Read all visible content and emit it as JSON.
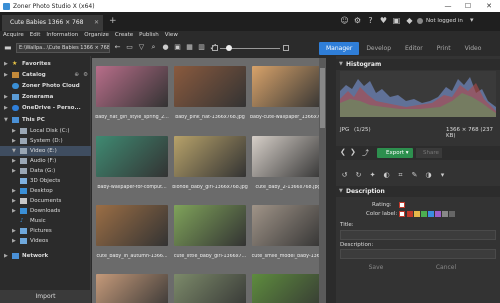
{
  "window": {
    "title": "Zoner Photo Studio X (x64)",
    "doc_tab": "Cute Babies 1366 × 768",
    "user_label": "Not logged in"
  },
  "menu": [
    "Acquire",
    "Edit",
    "Information",
    "Organize",
    "Create",
    "Publish",
    "View"
  ],
  "toolbar": {
    "path": "E:\\Wallpa...\\Cute Babies 1366 × 768"
  },
  "modes": [
    "Manager",
    "Develop",
    "Editor",
    "Print",
    "Video"
  ],
  "nav": {
    "favorites": "Favorites",
    "catalog": "Catalog",
    "cloud": "Zoner Photo Cloud",
    "zonerama": "Zonerama",
    "onedrive": "OneDrive - Perso...",
    "this_pc": "This PC",
    "drives": [
      "Local Disk (C:)",
      "System (D:)",
      "Video (E:)",
      "Audio (F:)",
      "Data (G:)"
    ],
    "folders": [
      "3D Objects",
      "Desktop",
      "Documents",
      "Downloads",
      "Music",
      "Pictures",
      "Videos"
    ],
    "network": "Network",
    "import": "Import"
  },
  "thumbs": [
    {
      "caption": "baby_hat_girl_style_spring_2...",
      "color": "#b86e8a"
    },
    {
      "caption": "baby_pink_hat-1366x768.jpg",
      "color": "#8a5a3e"
    },
    {
      "caption": "baby-cute-wallpaper_1366x768...",
      "color": "#d8a36a"
    },
    {
      "caption": "baby-wallpaper-for-comput...",
      "color": "#3f8a72"
    },
    {
      "caption": "blonde_baby_girl-1366x768.jpg",
      "color": "#b7a26a"
    },
    {
      "caption": "cute_baby_2-1366x768.jpg",
      "color": "#d6cfc8"
    },
    {
      "caption": "cute_baby_in_autumn-1366...",
      "color": "#9b6e45"
    },
    {
      "caption": "cute_little_baby_girl-1366x7...",
      "color": "#7fa35a"
    },
    {
      "caption": "cute_smile_model_baby-136...",
      "color": "#a09488"
    },
    {
      "caption": "",
      "color": "#c59a7a"
    },
    {
      "caption": "",
      "color": "#7c8a6a"
    },
    {
      "caption": "",
      "color": "#5e8c3e"
    }
  ],
  "panel": {
    "histogram_title": "Histogram",
    "format": "JPG",
    "index": "(1/25)",
    "dims": "1366 × 768 (237 KB)",
    "export_label": "Export",
    "share_label": "Share",
    "description_title": "Description",
    "rating_label": "Rating:",
    "color_label": "Color label:",
    "title_label": "Title:",
    "desc_label": "Description:",
    "save_label": "Save",
    "cancel_label": "Cancel",
    "label_colors": [
      "#c0392b",
      "#e6b84a",
      "#4caf50",
      "#3b8ee0",
      "#9c5fc9",
      "#888888",
      "#666666"
    ]
  },
  "accent": "#2f7ed8"
}
